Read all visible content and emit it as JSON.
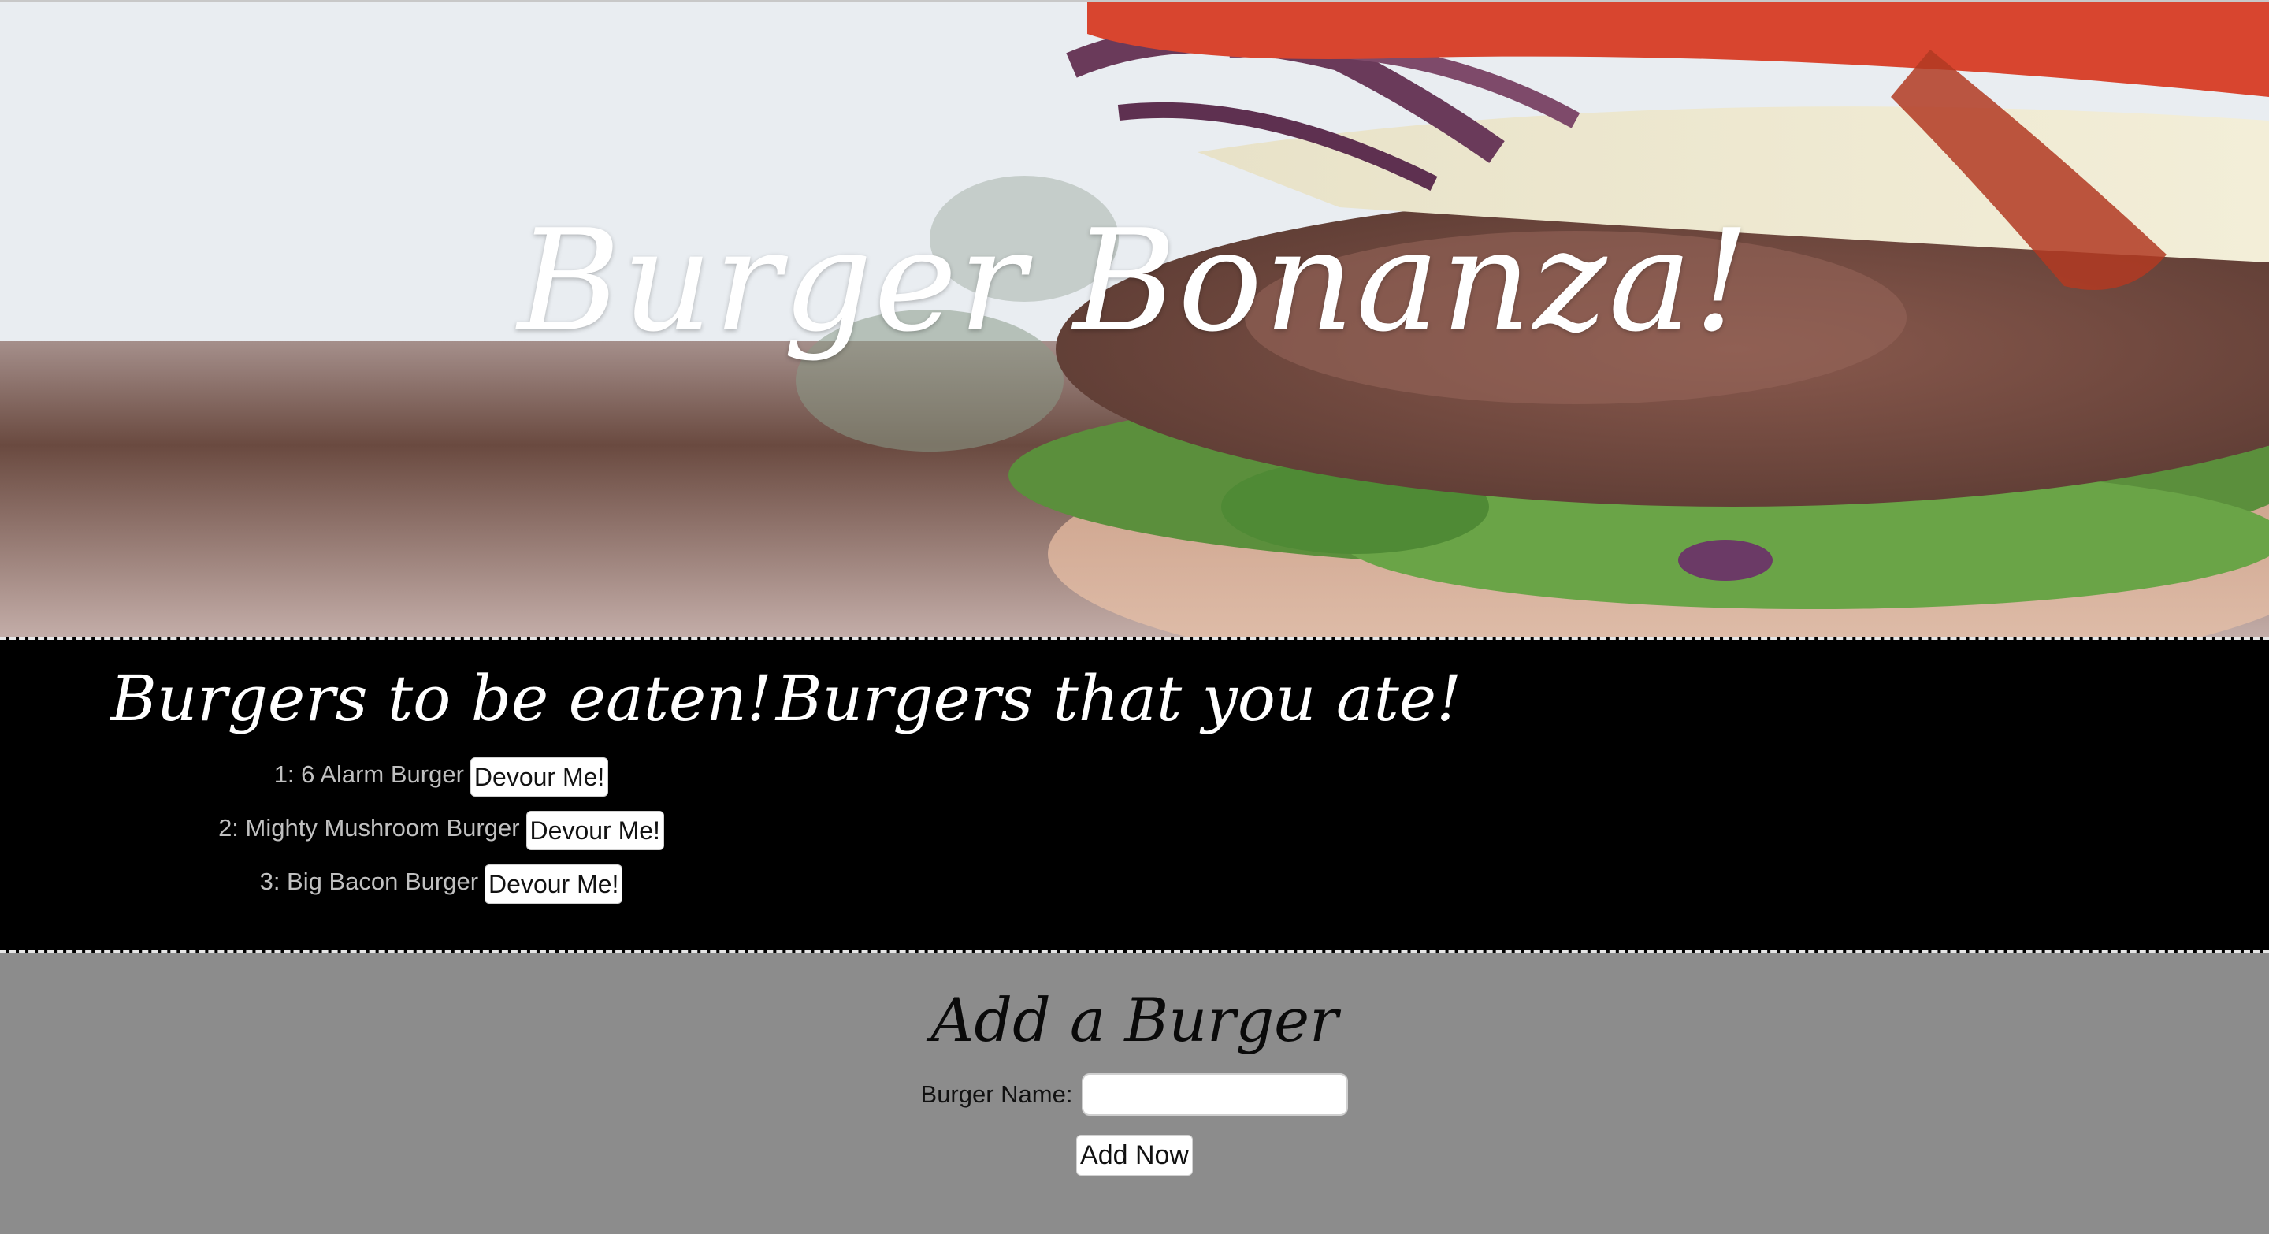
{
  "header": {
    "title": "Burger Bonanza!"
  },
  "to_eat": {
    "heading": "Burgers to be eaten!",
    "button_label": "Devour Me!",
    "items": [
      {
        "label": "1: 6 Alarm Burger"
      },
      {
        "label": "2: Mighty Mushroom Burger"
      },
      {
        "label": "3: Big Bacon Burger"
      }
    ]
  },
  "eaten": {
    "heading": "Burgers that you ate!",
    "items": []
  },
  "add_form": {
    "heading": "Add a Burger",
    "field_label": "Burger Name:",
    "field_value": "",
    "field_placeholder": "",
    "submit_label": "Add Now"
  },
  "colors": {
    "list_background": "#000000",
    "form_background": "#8c8c8c",
    "title_text": "#ffffff"
  },
  "icons": {
    "hero_image": "burger-photo"
  }
}
